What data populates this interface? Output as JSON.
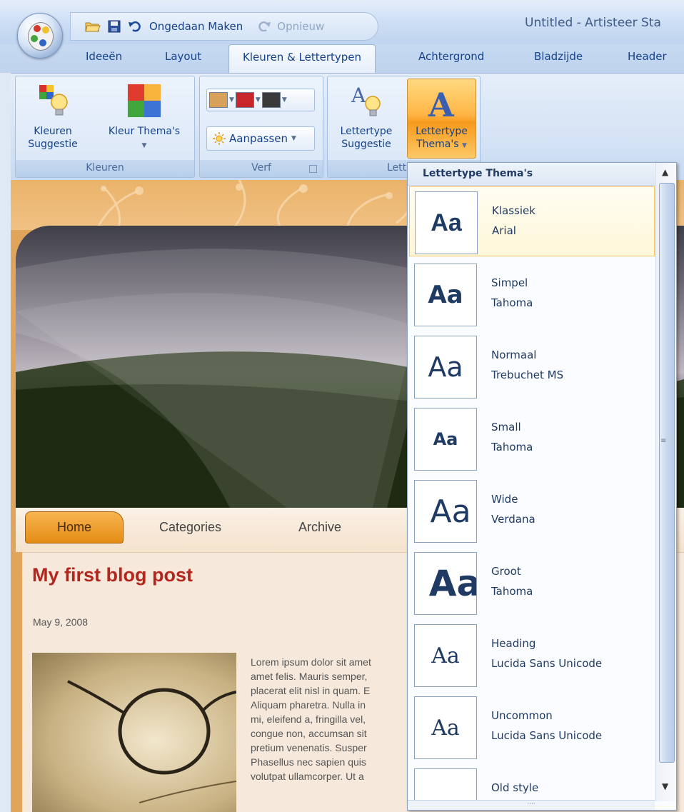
{
  "qat": {
    "undo_label": "Ongedaan Maken",
    "redo_label": "Opnieuw"
  },
  "app_title": "Untitled - Artisteer Sta",
  "tabs": [
    {
      "label": "Ideeën"
    },
    {
      "label": "Layout"
    },
    {
      "label": "Kleuren & Lettertypen"
    },
    {
      "label": "Achtergrond"
    },
    {
      "label": "Bladzijde"
    },
    {
      "label": "Header"
    }
  ],
  "ribbon": {
    "kleuren": {
      "title": "Kleuren",
      "suggest_label_1": "Kleuren",
      "suggest_label_2": "Suggestie",
      "theme_label": "Kleur Thema's"
    },
    "verf": {
      "title": "Verf",
      "swatches": [
        "#d8a15a",
        "#c8262a",
        "#3a3a3a"
      ],
      "aanpassen_label": "Aanpassen"
    },
    "lettertype": {
      "title": "Lettert",
      "suggest_label_1": "Lettertype",
      "suggest_label_2": "Suggestie",
      "theme_label_1": "Lettertype",
      "theme_label_2": "Thema's"
    }
  },
  "blog": {
    "nav": [
      "Home",
      "Categories",
      "Archive"
    ],
    "post_title": "My first blog post",
    "post_date": "May 9, 2008",
    "post_lines": [
      "Lorem ipsum dolor sit amet",
      "amet felis. Mauris semper,",
      "placerat elit nisl in quam. E",
      "Aliquam pharetra. Nulla in",
      "mi, eleifend a, fringilla vel,",
      "congue non, accumsan sit",
      "pretium venenatis. Susper",
      "Phasellus nec sapien quis",
      "volutpat ullamcorper. Ut a"
    ]
  },
  "gallery": {
    "title": "Lettertype Thema's",
    "sample": "Aa",
    "items": [
      {
        "name": "Klassiek",
        "font": "Arial",
        "selected": true
      },
      {
        "name": "Simpel",
        "font": "Tahoma"
      },
      {
        "name": "Normaal",
        "font": "Trebuchet MS"
      },
      {
        "name": "Small",
        "font": "Tahoma"
      },
      {
        "name": "Wide",
        "font": "Verdana"
      },
      {
        "name": "Groot",
        "font": "Tahoma"
      },
      {
        "name": "Heading",
        "font": "Lucida Sans Unicode"
      },
      {
        "name": "Uncommon",
        "font": "Lucida Sans Unicode"
      },
      {
        "name": "Old style",
        "font": ""
      }
    ]
  }
}
